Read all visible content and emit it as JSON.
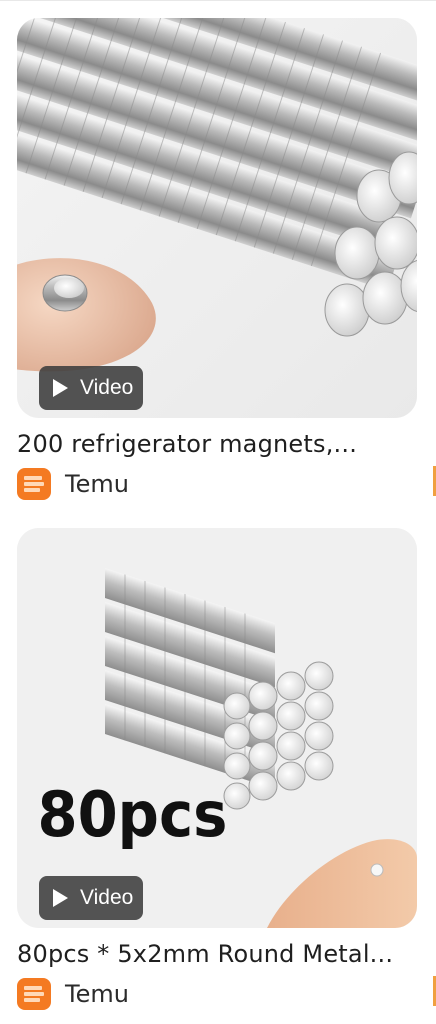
{
  "results": [
    {
      "badge_label": "Video",
      "title": "200 refrigerator magnets,...",
      "source_name": "Temu",
      "source_logo_icon": "temu-logo-icon",
      "image_subject": "stacks of small round silver magnets with a single magnet on a fingertip"
    },
    {
      "badge_label": "Video",
      "title": "80pcs * 5x2mm Round Metal...",
      "image_overlay_text": "80pcs",
      "source_name": "Temu",
      "source_logo_icon": "temu-logo-icon",
      "image_subject": "block of stacked small round silver magnets with a tiny magnet on a fingertip"
    }
  ],
  "colors": {
    "brand_accent": "#f47a22",
    "chip_background": "#3c3c3c"
  }
}
